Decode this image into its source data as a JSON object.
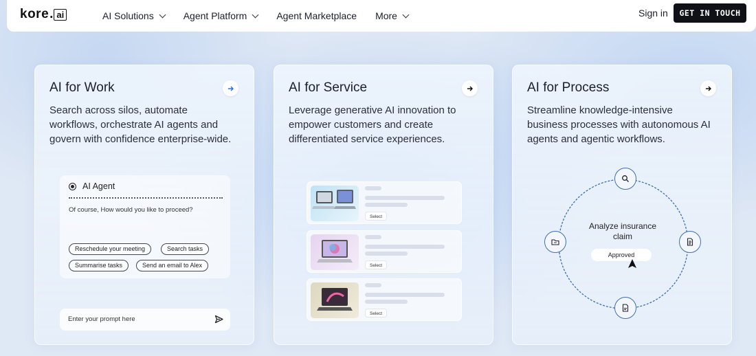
{
  "nav": {
    "logo_left": "kore",
    "logo_dot": ".",
    "logo_box": "ai",
    "menu": [
      {
        "label": "AI Solutions",
        "has_dropdown": true
      },
      {
        "label": "Agent Platform",
        "has_dropdown": true
      },
      {
        "label": "Agent Marketplace",
        "has_dropdown": false
      },
      {
        "label": "More",
        "has_dropdown": true
      }
    ],
    "signin": "Sign in",
    "cta": "GET IN TOUCH"
  },
  "cards": [
    {
      "title": "AI for Work",
      "description": "Search across silos, automate workflows, orchestrate AI agents and govern with confidence enterprise-wide.",
      "agent_title": "AI Agent",
      "agent_reply": "Of course, How would you like to proceed?",
      "chips": [
        "Reschedule your meeting",
        "Search tasks",
        "Summarise tasks",
        "Send an email to Alex"
      ],
      "prompt_placeholder": "Enter your prompt here"
    },
    {
      "title": "AI for Service",
      "description": "Leverage generative AI innovation to empower customers and create differentiated service experiences.",
      "select_label": "Select"
    },
    {
      "title": "AI for Process",
      "description": "Streamline knowledge-intensive business processes with autonomous AI agents and agentic workflows.",
      "center_text": "Analyze insurance claim",
      "status": "Approved",
      "node_icons": [
        "search-icon",
        "document-icon",
        "file-icon",
        "folder-icon"
      ]
    }
  ],
  "colors": {
    "cta_bg": "#0f1117",
    "cycle_line": "#3d6fb0",
    "page_bg": "#dfe8f5"
  }
}
